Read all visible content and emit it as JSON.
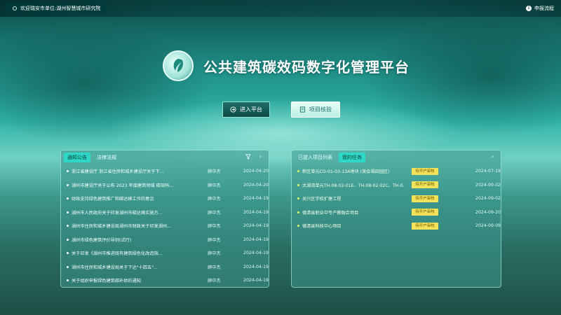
{
  "topbar": {
    "welcome": "欢迎瑞安市单位:湖州智慧城市研究院",
    "declare": "申报流程"
  },
  "header": {
    "title": "公共建筑碳效码数字化管理平台"
  },
  "buttons": {
    "enter": "进入平台",
    "check": "项目核验"
  },
  "left_panel": {
    "tabs": [
      "通知公告",
      "法律法规"
    ],
    "active_tab": 0,
    "rows": [
      {
        "title": "浙江省建设厅 浙江省住房和城乡建设厅关于下...",
        "source": "薛中杰",
        "date": "2024-04-20"
      },
      {
        "title": "湖州市建设厅关于公布 2023 年度建筑领域 碳效码...",
        "source": "薛中杰",
        "date": "2024-04-20"
      },
      {
        "title": "财政支持绿色建筑推广和碳达峰工作的意见",
        "source": "薛中杰",
        "date": "2024-04-19"
      },
      {
        "title": "湖州市人民政府关于印发湖州市碳达峰实施方...",
        "source": "薛中杰",
        "date": "2024-04-19"
      },
      {
        "title": "湖州市住房和城乡建设局湖州市财政关于印发湖州...",
        "source": "薛中杰",
        "date": "2024-04-19"
      },
      {
        "title": "湖州市绿色建筑评价导则(试行)",
        "source": "薛中杰",
        "date": "2024-04-19"
      },
      {
        "title": "关于印发《湖州市推进既有建筑绿色化改造指...",
        "source": "薛中杰",
        "date": "2024-04-19"
      },
      {
        "title": "湖州市住房和城乡建设局关于下达\"十四五\"...",
        "source": "薛中杰",
        "date": "2024-04-19"
      },
      {
        "title": "关于组织申报绿色建筑碳补助的通知",
        "source": "薛中杰",
        "date": "2024-04-19"
      }
    ]
  },
  "right_panel": {
    "tabs": [
      "已提入项目列表",
      "我的任务"
    ],
    "active_tab": 1,
    "rows": [
      {
        "title": "新区单元CD-01-03-13A地块 (美会福田园区)",
        "status": "待开户审核",
        "date": "2024-07-19"
      },
      {
        "title": "太湖湾单元TH-08-02-01E、TH-08-02-02C、TH-0...",
        "status": "待开户审核",
        "date": "2024-09-02"
      },
      {
        "title": "吴兴区学校扩建工程",
        "status": "待开户审核",
        "date": "2024-09-02"
      },
      {
        "title": "德清县职业中专产教融合项目",
        "status": "待开户审核",
        "date": "2024-09-20"
      },
      {
        "title": "德清县科技中心项目",
        "status": "待开户审核",
        "date": "2024-09-09"
      }
    ]
  }
}
